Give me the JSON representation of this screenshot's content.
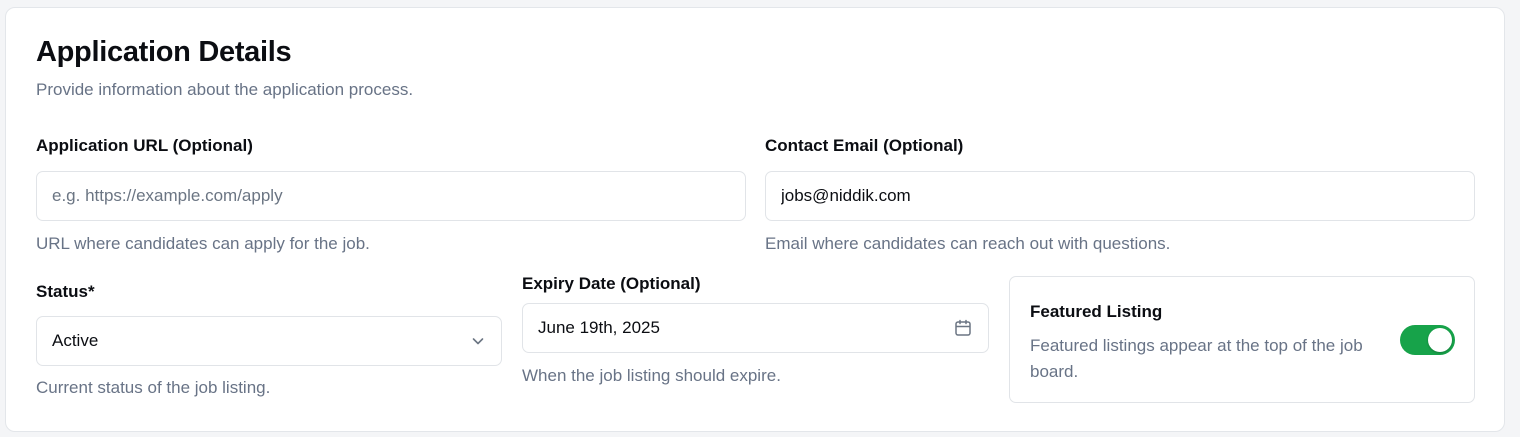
{
  "header": {
    "title": "Application Details",
    "subtitle": "Provide information about the application process."
  },
  "application_url": {
    "label": "Application URL (Optional)",
    "value": "",
    "placeholder": "e.g. https://example.com/apply",
    "help": "URL where candidates can apply for the job."
  },
  "contact_email": {
    "label": "Contact Email (Optional)",
    "value": "jobs@niddik.com",
    "placeholder": "",
    "help": "Email where candidates can reach out with questions."
  },
  "status": {
    "label": "Status*",
    "value": "Active",
    "help": "Current status of the job listing.",
    "icon": "chevron-down-icon"
  },
  "expiry_date": {
    "label": "Expiry Date (Optional)",
    "value": "June 19th, 2025",
    "help": "When the job listing should expire.",
    "icon": "calendar-icon"
  },
  "featured": {
    "title": "Featured Listing",
    "description": "Featured listings appear at the top of the job board.",
    "enabled": true,
    "accent_color": "#17a34a"
  }
}
